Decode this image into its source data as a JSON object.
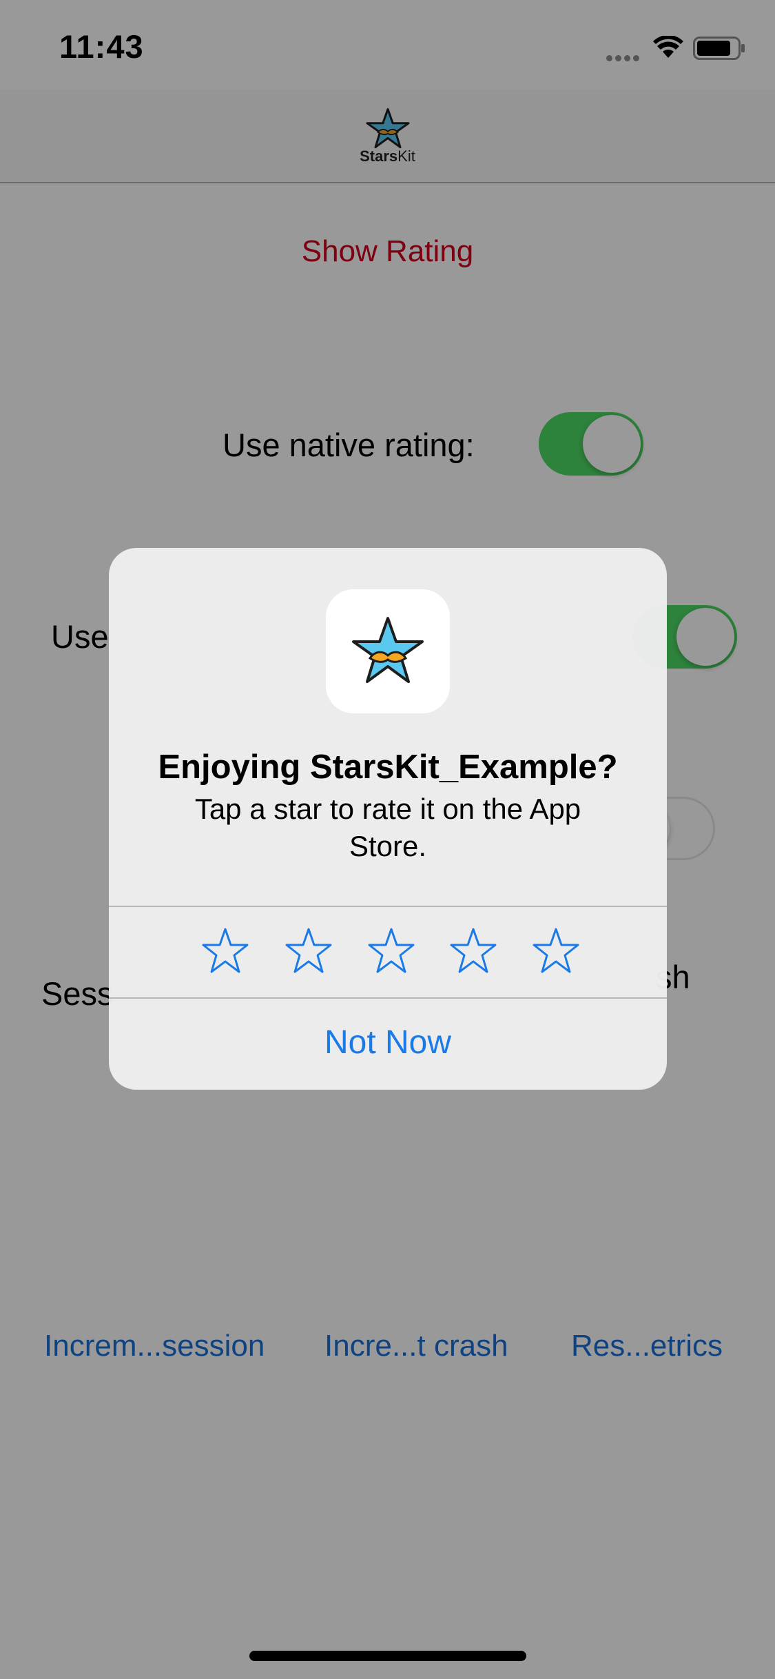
{
  "status_bar": {
    "time": "11:43"
  },
  "navbar": {
    "brand_bold": "Stars",
    "brand_thin": "Kit"
  },
  "main": {
    "show_rating_label": "Show Rating",
    "rows": [
      {
        "label": "Use native rating:",
        "toggle_on": true
      },
      {
        "label": "Use",
        "toggle_on": true
      },
      {
        "label": "",
        "toggle_on": false
      },
      {
        "label": "Sess",
        "right_label": "sh"
      }
    ],
    "bottom_buttons": [
      "Increm...session",
      "Incre...t crash",
      "Res...etrics"
    ]
  },
  "alert": {
    "title": "Enjoying StarsKit_Example?",
    "message": "Tap a star to rate it on the App Store.",
    "star_count": 5,
    "dismiss_label": "Not Now"
  },
  "colors": {
    "accent_red": "#d0021b",
    "toggle_green": "#4cd964",
    "system_blue": "#1a7ae8",
    "logo_star_blue": "#5bc8ef",
    "logo_mustache": "#f5a623"
  }
}
